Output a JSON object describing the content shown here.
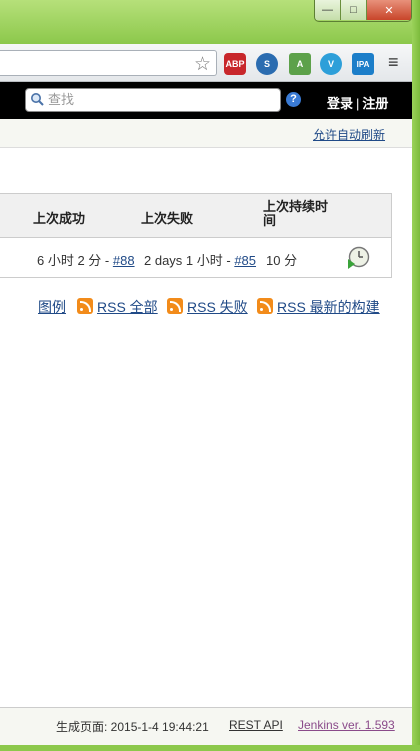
{
  "window": {
    "minimize_glyph": "—",
    "maximize_glyph": "□",
    "close_glyph": "✕"
  },
  "browser": {
    "extensions": [
      "ABP",
      "S",
      "A",
      "V",
      "IPA"
    ],
    "menu_glyph": "≡",
    "star_glyph": "☆"
  },
  "header": {
    "search_placeholder": "查找",
    "help_label": "?",
    "login_label": "登录",
    "separator": "|",
    "register_label": "注册"
  },
  "subbar": {
    "auto_refresh": "允许自动刷新"
  },
  "table": {
    "headers": [
      "上次成功",
      "上次失败",
      "上次持续时间"
    ],
    "row": {
      "last_success_text": "6 小时 2 分 - ",
      "last_success_link": "#88",
      "last_failure_text": "2 days 1 小时 - ",
      "last_failure_link": "#85",
      "last_duration": "10 分"
    }
  },
  "links": {
    "legend": "图例",
    "rss_all": "RSS 全部",
    "rss_failed": "RSS 失败",
    "rss_latest": "RSS 最新的构建"
  },
  "footer": {
    "generated_label": "生成页面: 2015-1-4 19:44:21",
    "rest_api": "REST API",
    "version": "Jenkins ver. 1.593"
  },
  "colors": {
    "frame": "#8cc84b",
    "header_bg": "#000000",
    "link": "#204a87",
    "rss": "#f28b1a"
  }
}
